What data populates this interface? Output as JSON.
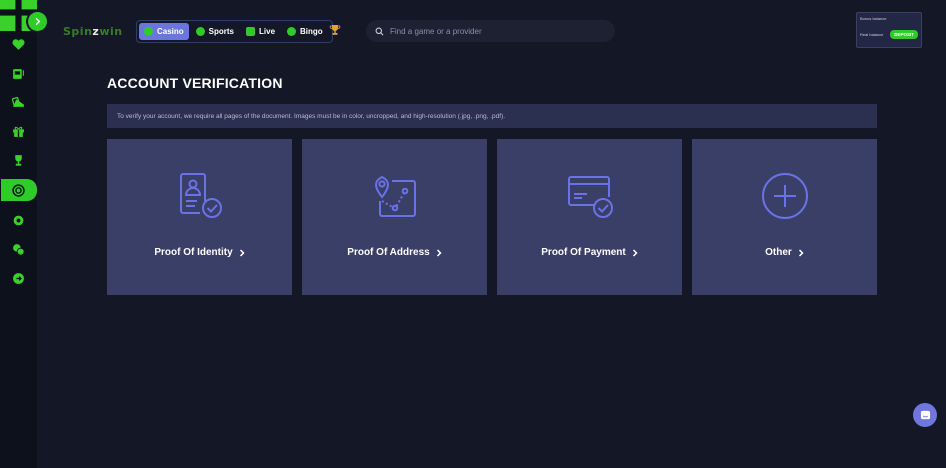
{
  "header": {
    "logo_main": "Spin",
    "logo_accent": "z",
    "logo_tail": "win",
    "nav": [
      {
        "label": "Casino",
        "active": true
      },
      {
        "label": "Sports",
        "active": false
      },
      {
        "label": "Live",
        "active": false
      },
      {
        "label": "Bingo",
        "active": false
      }
    ],
    "search_placeholder": "Find a game or a provider",
    "balance": {
      "bonus_label": "Bonus balance",
      "real_label": "Real balance",
      "deposit_label": "DEPOSIT"
    }
  },
  "sidebar": {
    "items": [
      {
        "icon": "grid-icon",
        "active": false
      },
      {
        "icon": "heart-icon",
        "active": false
      },
      {
        "icon": "slot-machine-icon",
        "active": false
      },
      {
        "icon": "cards-icon",
        "active": false
      },
      {
        "icon": "gift-icon",
        "active": false
      },
      {
        "icon": "trophy-icon",
        "active": false
      },
      {
        "icon": "chip-icon",
        "active": true
      },
      {
        "icon": "settings-icon",
        "active": false
      },
      {
        "icon": "chat-bubbles-icon",
        "active": false
      },
      {
        "icon": "logout-icon",
        "active": false
      }
    ]
  },
  "main": {
    "title": "ACCOUNT VERIFICATION",
    "notice": "To verify your account, we require all pages of the document. Images must be in color, uncropped, and high-resolution (.jpg, .png, .pdf).",
    "cards": [
      {
        "label": "Proof Of Identity",
        "icon": "id-card-check-icon"
      },
      {
        "label": "Proof Of Address",
        "icon": "map-route-icon"
      },
      {
        "label": "Proof Of Payment",
        "icon": "credit-card-check-icon"
      },
      {
        "label": "Other",
        "icon": "plus-circle-icon"
      }
    ]
  },
  "colors": {
    "accent_green": "#2fcb29",
    "accent_purple": "#6b76dd",
    "card_bg": "#3a3f67",
    "page_bg": "#141826"
  }
}
